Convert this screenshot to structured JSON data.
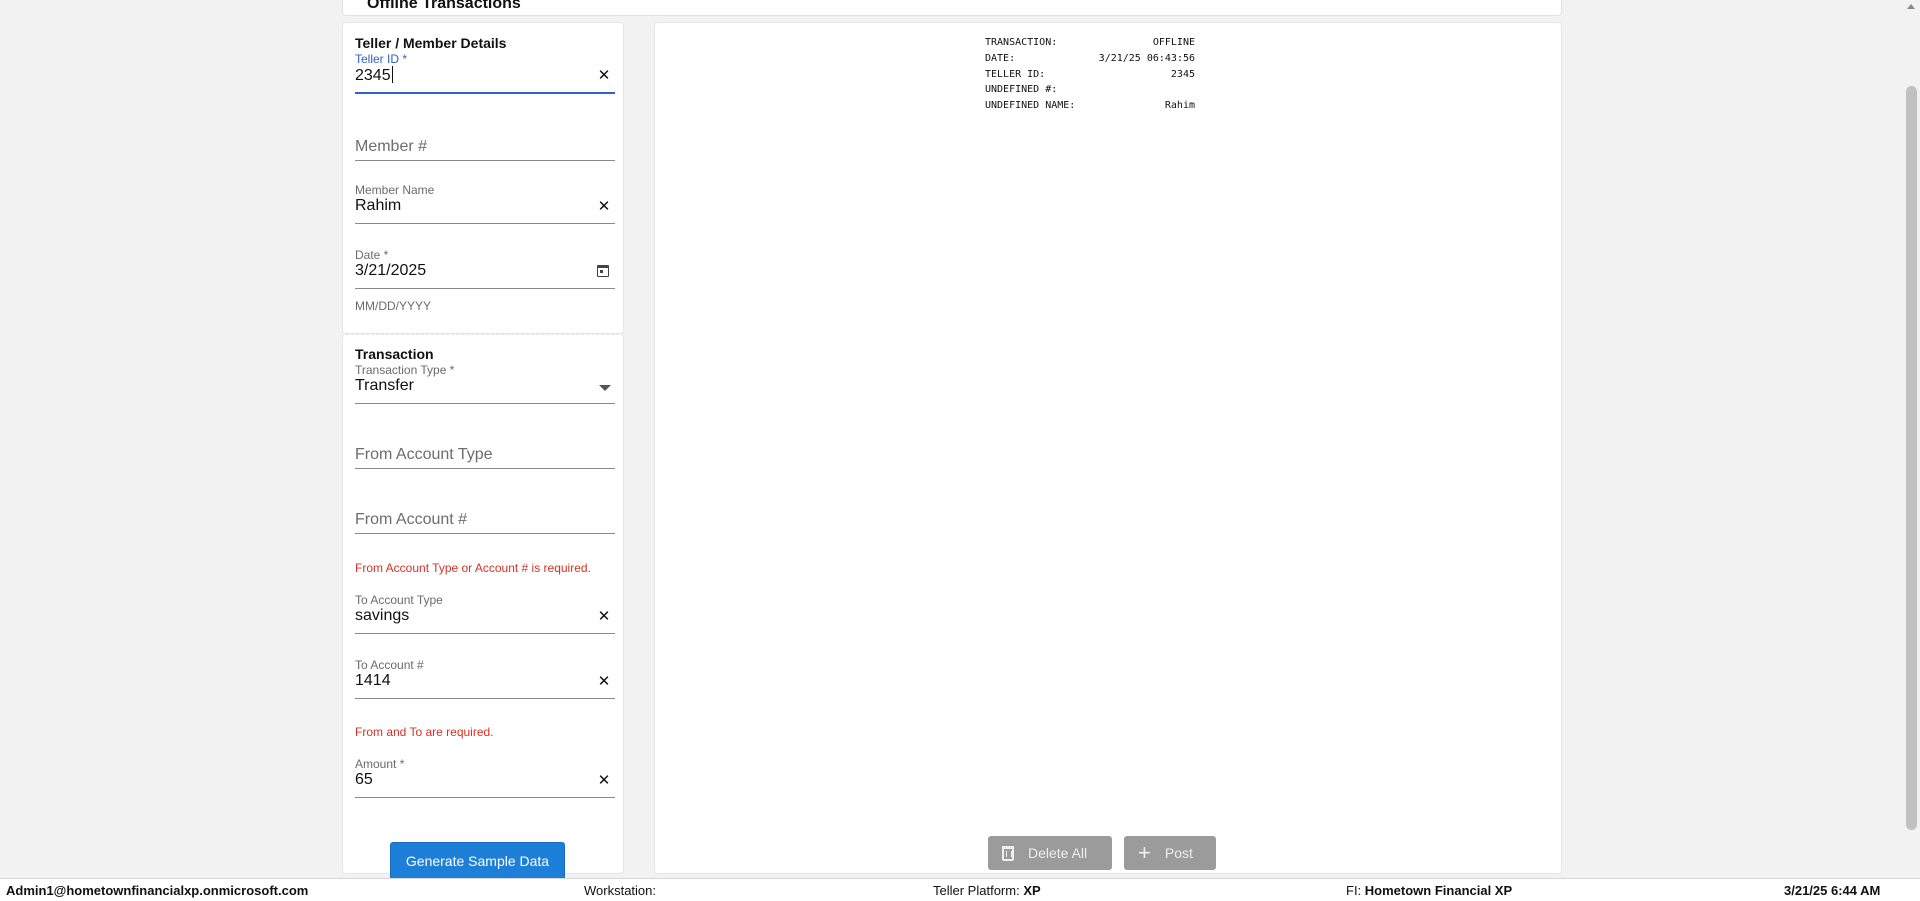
{
  "header": {
    "title": "Offline Transactions"
  },
  "teller_section": {
    "title": "Teller / Member Details",
    "teller_id": {
      "label": "Teller ID *",
      "value": "2345"
    },
    "member_number": {
      "placeholder": "Member #"
    },
    "member_name": {
      "label": "Member Name",
      "value": "Rahim"
    },
    "date": {
      "label": "Date *",
      "value": "3/21/2025",
      "helper": "MM/DD/YYYY"
    }
  },
  "transaction_section": {
    "title": "Transaction",
    "transaction_type": {
      "label": "Transaction Type *",
      "value": "Transfer"
    },
    "from_account_type": {
      "placeholder": "From Account Type"
    },
    "from_account_number": {
      "placeholder": "From Account #"
    },
    "from_error": "From Account Type or Account # is required.",
    "to_account_type": {
      "label": "To Account Type",
      "value": "savings"
    },
    "to_account_number": {
      "label": "To Account #",
      "value": "1414"
    },
    "to_error": "From and To are required.",
    "amount": {
      "label": "Amount *",
      "value": "65"
    }
  },
  "generate_button": "Generate Sample Data",
  "receipt": {
    "rows": [
      {
        "key": "TRANSACTION:",
        "value": "OFFLINE"
      },
      {
        "key": "DATE:",
        "value": "3/21/25 06:43:56"
      },
      {
        "key": "TELLER ID:",
        "value": "2345"
      },
      {
        "key": "UNDEFINED #:",
        "value": ""
      },
      {
        "key": "UNDEFINED NAME:",
        "value": "Rahim"
      }
    ]
  },
  "actions": {
    "delete_all": "Delete All",
    "post": "Post"
  },
  "status_bar": {
    "user": "Admin1@hometownfinancialxp.onmicrosoft.com",
    "workstation_label": "Workstation:",
    "workstation_value": "",
    "platform_label": "Teller Platform:",
    "platform_value": "XP",
    "fi_label": "FI:",
    "fi_value": "Hometown Financial XP",
    "datetime": "3/21/25 6:44 AM"
  },
  "colors": {
    "accent_blue": "#2f63c9",
    "button_blue": "#1e7fd8",
    "error_red": "#d93025",
    "disabled_gray": "#9b9b9b"
  },
  "icons": [
    "clear-icon",
    "calendar-icon",
    "dropdown-arrow-icon",
    "trash-icon",
    "plus-icon"
  ]
}
